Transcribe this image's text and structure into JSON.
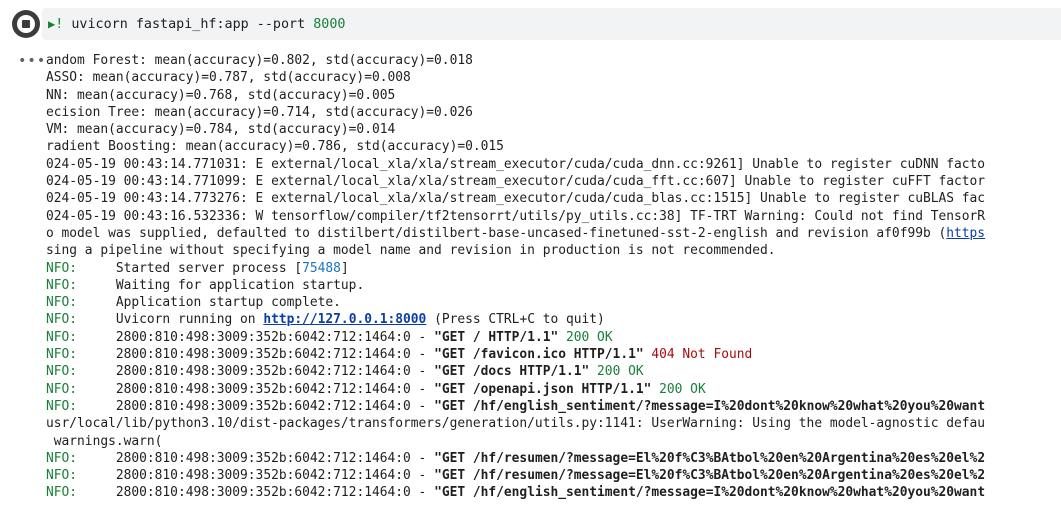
{
  "cell": {
    "command_bang": "!",
    "command_main": " uvicorn fastapi_hf:app --port ",
    "command_port": "8000",
    "run_icon": "stop-circle-icon",
    "output_menu_icon": "ellipsis-icon",
    "output_menu_glyph": "•••"
  },
  "output": {
    "metrics": [
      "andom Forest: mean(accuracy)=0.802, std(accuracy)=0.018",
      "ASSO: mean(accuracy)=0.787, std(accuracy)=0.008",
      "NN: mean(accuracy)=0.768, std(accuracy)=0.005",
      "ecision Tree: mean(accuracy)=0.714, std(accuracy)=0.026",
      "VM: mean(accuracy)=0.784, std(accuracy)=0.014",
      "radient Boosting: mean(accuracy)=0.786, std(accuracy)=0.015"
    ],
    "warnings": [
      "024-05-19 00:43:14.771031: E external/local_xla/xla/stream_executor/cuda/cuda_dnn.cc:9261] Unable to register cuDNN facto",
      "024-05-19 00:43:14.771099: E external/local_xla/xla/stream_executor/cuda/cuda_fft.cc:607] Unable to register cuFFT factor",
      "024-05-19 00:43:14.773276: E external/local_xla/xla/stream_executor/cuda/cuda_blas.cc:1515] Unable to register cuBLAS fac",
      "024-05-19 00:43:16.532336: W tensorflow/compiler/tf2tensorrt/utils/py_utils.cc:38] TF-TRT Warning: Could not find TensorR"
    ],
    "model_line_text": "o model was supplied, defaulted to distilbert/distilbert-base-uncased-finetuned-sst-2-english and revision af0f99b (",
    "model_line_link": "https",
    "pipeline_line": "sing a pipeline without specifying a model name and revision in production is not recommended.",
    "info_prefix": "NFO:",
    "started_text": "Started server process [",
    "pid": "75488",
    "started_close": "]",
    "waiting": "Waiting for application startup.",
    "startup_complete": "Application startup complete.",
    "running_text": "Uvicorn running on ",
    "running_url": "http://127.0.0.1:8000",
    "running_tail": " (Press CTRL+C to quit)",
    "requests": [
      {
        "client": "2800:810:498:3009:352b:6042:712:1464:0 - ",
        "request": "\"GET / HTTP/1.1\"",
        "status": " 200 OK",
        "error": false
      },
      {
        "client": "2800:810:498:3009:352b:6042:712:1464:0 - ",
        "request": "\"GET /favicon.ico HTTP/1.1\"",
        "status": " 404 Not Found",
        "error": true
      },
      {
        "client": "2800:810:498:3009:352b:6042:712:1464:0 - ",
        "request": "\"GET /docs HTTP/1.1\"",
        "status": " 200 OK",
        "error": false
      },
      {
        "client": "2800:810:498:3009:352b:6042:712:1464:0 - ",
        "request": "\"GET /openapi.json HTTP/1.1\"",
        "status": " 200 OK",
        "error": false
      },
      {
        "client": "2800:810:498:3009:352b:6042:712:1464:0 - ",
        "request": "\"GET /hf/english_sentiment/?message=I%20dont%20know%20what%20you%20want",
        "status": "",
        "error": false
      }
    ],
    "userwarning_line": "usr/local/lib/python3.10/dist-packages/transformers/generation/utils.py:1141: UserWarning: Using the model-agnostic defau",
    "warn_call_line": " warnings.warn(",
    "requests_tail": [
      {
        "client": "2800:810:498:3009:352b:6042:712:1464:0 - ",
        "request": "\"GET /hf/resumen/?message=El%20f%C3%BAtbol%20en%20Argentina%20es%20el%2"
      },
      {
        "client": "2800:810:498:3009:352b:6042:712:1464:0 - ",
        "request": "\"GET /hf/resumen/?message=El%20f%C3%BAtbol%20en%20Argentina%20es%20el%2"
      },
      {
        "client": "2800:810:498:3009:352b:6042:712:1464:0 - ",
        "request": "\"GET /hf/english_sentiment/?message=I%20dont%20know%20what%20you%20want"
      }
    ]
  }
}
